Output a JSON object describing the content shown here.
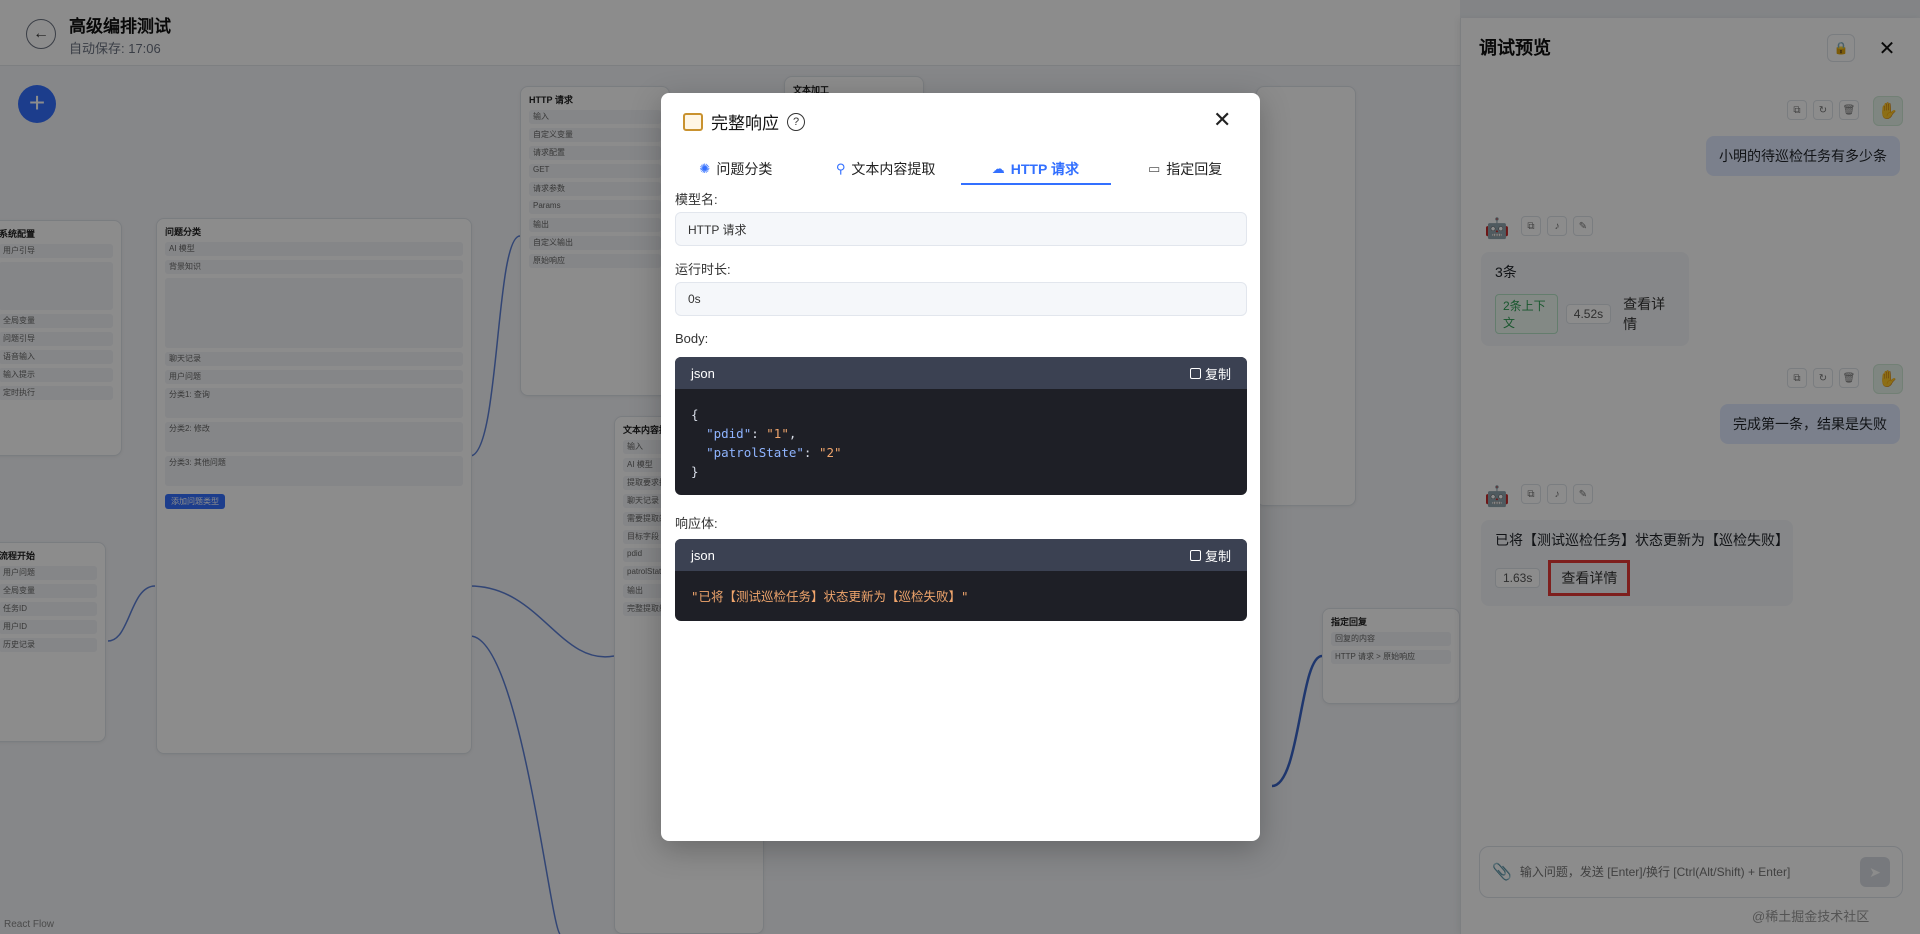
{
  "header": {
    "title": "高级编排测试",
    "autosave": "自动保存: 17:06"
  },
  "canvas": {
    "add_label": "+",
    "footer_label": "React Flow",
    "nodes": {
      "config": {
        "title": "系统配置",
        "lines": [
          "用户引导",
          "全局变量",
          "问题引导",
          "语音输入",
          "输入提示",
          "定时执行"
        ]
      },
      "flow_start": {
        "title": "流程开始",
        "lines": [
          "用户问题",
          "全局变量",
          "任务ID",
          "用户ID",
          "历史记录"
        ]
      },
      "classify": {
        "title": "问题分类",
        "model": "AI 模型",
        "lines": [
          "背景知识",
          "聊天记录",
          "用户问题",
          "分类1: 查询",
          "分类2: 修改",
          "分类3: 其他问题"
        ],
        "button": "添加问题类型"
      },
      "http": {
        "title": "HTTP 请求",
        "lines": [
          "输入",
          "自定义变量",
          "请求配置",
          "GET",
          "请求参数",
          "Params",
          "输出",
          "自定义输出",
          "原始响应"
        ]
      },
      "text_extract": {
        "title": "文本内容提取",
        "lines": [
          "输入",
          "AI 模型",
          "提取要求描述",
          "聊天记录",
          "需要提取的文本",
          "目标字段",
          "pdid",
          "patrolState",
          "输出",
          "完整提取结果"
        ]
      },
      "text_process": {
        "title": "文本加工",
        "lines": []
      },
      "reply": {
        "title": "指定回复",
        "lines": [
          "回复的内容",
          "HTTP 请求 > 原始响应"
        ]
      }
    }
  },
  "panel": {
    "title": "调试预览",
    "messages": [
      {
        "role": "user",
        "text": "小明的待巡检任务有多少条"
      },
      {
        "role": "bot",
        "text": "3条",
        "context_tag": "2条上下文",
        "time": "4.52s",
        "detail": "查看详情"
      },
      {
        "role": "user",
        "text": "完成第一条，结果是失败"
      },
      {
        "role": "bot",
        "text": "已将【测试巡检任务】状态更新为【巡检失败】",
        "time": "1.63s",
        "detail": "查看详情"
      }
    ],
    "input_placeholder": "输入问题，发送 [Enter]/换行 [Ctrl(Alt/Shift) + Enter]",
    "watermark": "@稀土掘金技术社区"
  },
  "modal": {
    "title": "完整响应",
    "tabs": [
      {
        "label": "问题分类",
        "icon": "brain-icon"
      },
      {
        "label": "文本内容提取",
        "icon": "extract-icon"
      },
      {
        "label": "HTTP 请求",
        "icon": "cloud-icon",
        "active": true
      },
      {
        "label": "指定回复",
        "icon": "reply-icon"
      }
    ],
    "model_label": "模型名:",
    "model_value": "HTTP 请求",
    "runtime_label": "运行时长:",
    "runtime_value": "0s",
    "body_label": "Body:",
    "body_lang": "json",
    "copy_label": "复制",
    "body_code": {
      "open": "{",
      "k1": "\"pdid\"",
      "v1": "\"1\"",
      "k2": "\"patrolState\"",
      "v2": "\"2\"",
      "close": "}"
    },
    "response_label": "响应体:",
    "response_lang": "json",
    "response_code": "\"已将【测试巡检任务】状态更新为【巡检失败】\""
  }
}
